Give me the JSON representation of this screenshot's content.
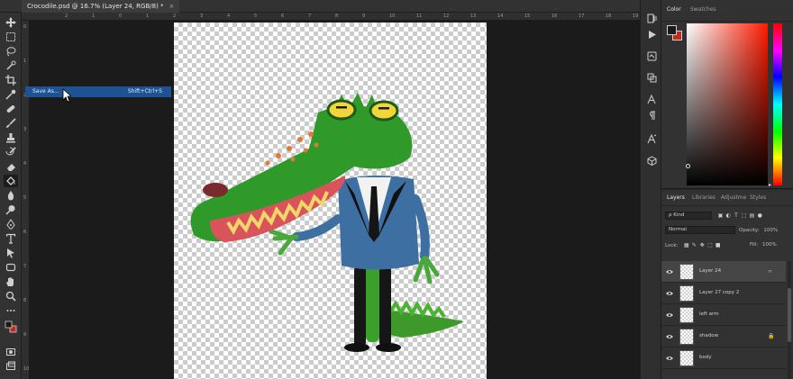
{
  "document": {
    "tab_title": "Crocodile.psd @ 16.7% (Layer 24, RGB/8) *",
    "close_glyph": "×"
  },
  "ruler": {
    "top_ticks": [
      "2",
      "1",
      "0",
      "1",
      "2",
      "3",
      "4",
      "5",
      "6",
      "7",
      "8",
      "9",
      "10",
      "11",
      "12",
      "13",
      "14",
      "15",
      "16",
      "17",
      "18",
      "19"
    ],
    "left_ticks": [
      "0",
      "1",
      "2",
      "3",
      "4",
      "5",
      "6",
      "7",
      "8",
      "9",
      "10"
    ]
  },
  "context_menu": {
    "item_label": "Save As...",
    "item_shortcut": "Shift+Ctrl+S"
  },
  "toolbar": {
    "tools": [
      "move-tool",
      "marquee-tool",
      "lasso-tool",
      "quick-select-tool",
      "crop-tool",
      "eyedropper-tool",
      "healing-tool",
      "brush-tool",
      "clone-stamp-tool",
      "history-brush-tool",
      "eraser-tool",
      "paint-bucket-tool",
      "blur-tool",
      "dodge-tool",
      "pen-tool",
      "type-tool",
      "path-select-tool",
      "rectangle-tool",
      "hand-tool",
      "zoom-tool",
      "more-tools"
    ],
    "active_tool": "paint-bucket-tool",
    "foreground_color": "#1a1a1a",
    "background_color": "#c22a1b"
  },
  "color_panel": {
    "tabs": [
      "Color",
      "Swatches"
    ],
    "active_tab": "Color",
    "foreground_color": "#1a1a1a",
    "background_color": "#c22a1b",
    "hue_color": "#ff1a00"
  },
  "layers_panel": {
    "tabs": [
      "Layers",
      "Libraries",
      "Adjustme",
      "Styles"
    ],
    "active_tab": "Layers",
    "filter_label": "Kind",
    "filter_icon_label": "ρ",
    "blend_mode": "Normal",
    "opacity_label": "Opacity:",
    "opacity_value": "100%",
    "lock_label": "Lock:",
    "fill_label": "Fill:",
    "fill_value": "100%",
    "layers": [
      {
        "name": "Layer 24",
        "visible": true,
        "selected": true,
        "badge": "∞"
      },
      {
        "name": "Layer 27 copy 2",
        "visible": true,
        "selected": false,
        "badge": ""
      },
      {
        "name": "left arm",
        "visible": true,
        "selected": false,
        "badge": ""
      },
      {
        "name": "shadow",
        "visible": true,
        "selected": false,
        "badge": "🔒"
      },
      {
        "name": "body",
        "visible": true,
        "selected": false,
        "badge": ""
      }
    ]
  },
  "right_strip": {
    "icons": [
      "history-icon",
      "play-icon",
      "adjustments-icon",
      "libraries-icon",
      "character-icon",
      "paragraph-icon",
      "glyphs-icon",
      "3d-icon"
    ]
  }
}
